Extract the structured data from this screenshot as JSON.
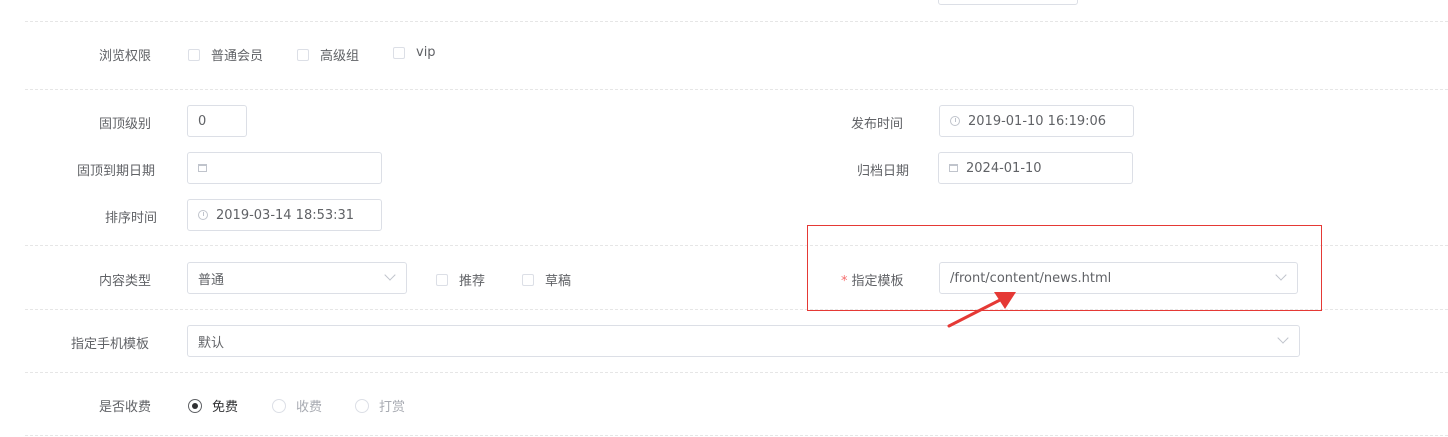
{
  "permissions": {
    "label": "浏览权限",
    "options": [
      "普通会员",
      "高级组",
      "vip"
    ]
  },
  "sticky_level": {
    "label": "固顶级别",
    "value": "0"
  },
  "publish_time": {
    "label": "发布时间",
    "value": "2019-01-10 16:19:06",
    "icon": "clock-icon"
  },
  "sticky_expire": {
    "label": "固顶到期日期",
    "value": "",
    "icon": "calendar-icon"
  },
  "archive_date": {
    "label": "归档日期",
    "value": "2024-01-10",
    "icon": "calendar-icon"
  },
  "sort_time": {
    "label": "排序时间",
    "value": "2019-03-14 18:53:31",
    "icon": "clock-icon"
  },
  "content_type": {
    "label": "内容类型",
    "value": "普通",
    "checkboxes": [
      "推荐",
      "草稿"
    ]
  },
  "template": {
    "required_mark": "*",
    "label": "指定模板",
    "value": "/front/content/news.html"
  },
  "mobile_template": {
    "label": "指定手机模板",
    "value": "默认"
  },
  "charge": {
    "label": "是否收费",
    "options": [
      "免费",
      "收费",
      "打赏"
    ],
    "selected": "免费"
  },
  "annotation": {
    "highlight_color": "#e53935",
    "arrow_color": "#e53935"
  }
}
